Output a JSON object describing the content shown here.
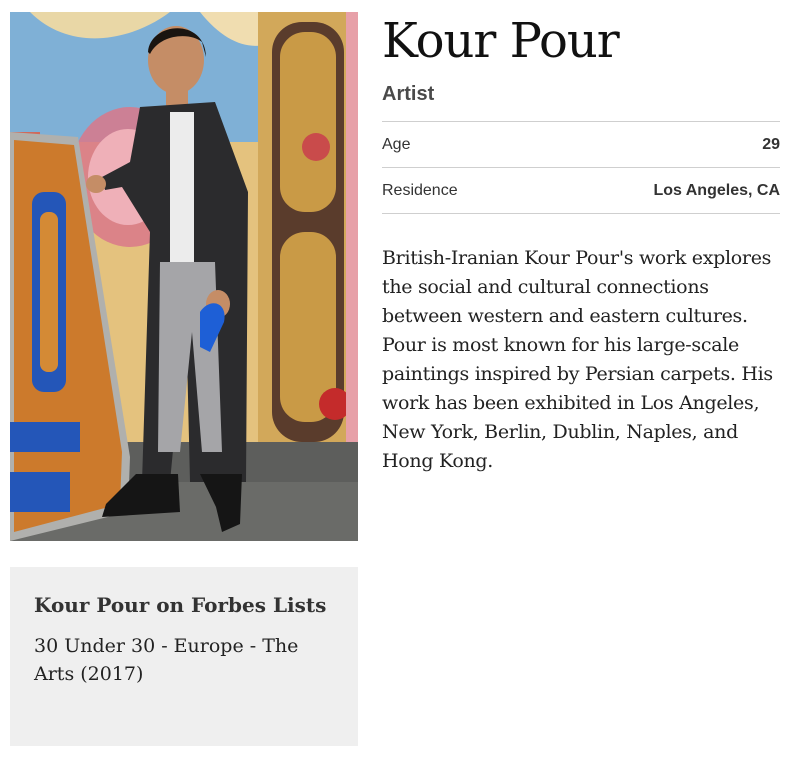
{
  "profile": {
    "name": "Kour Pour",
    "title": "Artist",
    "stats": [
      {
        "label": "Age",
        "value": "29"
      },
      {
        "label": "Residence",
        "value": "Los Angeles, CA"
      }
    ],
    "bio": "British-Iranian Kour Pour's work explores the social and cultural connections between western and eastern cultures. Pour is most known for his large-scale paintings inspired by Persian carpets. His work has been exhibited in Los Angeles, New York, Berlin, Dublin, Naples, and Hong Kong."
  },
  "lists_box": {
    "heading": "Kour Pour on Forbes Lists",
    "items": [
      "30 Under 30 - Europe - The Arts (2017)"
    ]
  },
  "colors": {
    "panel_background": "#efefef",
    "divider": "#cfcfcf",
    "text_dark": "#111111"
  }
}
